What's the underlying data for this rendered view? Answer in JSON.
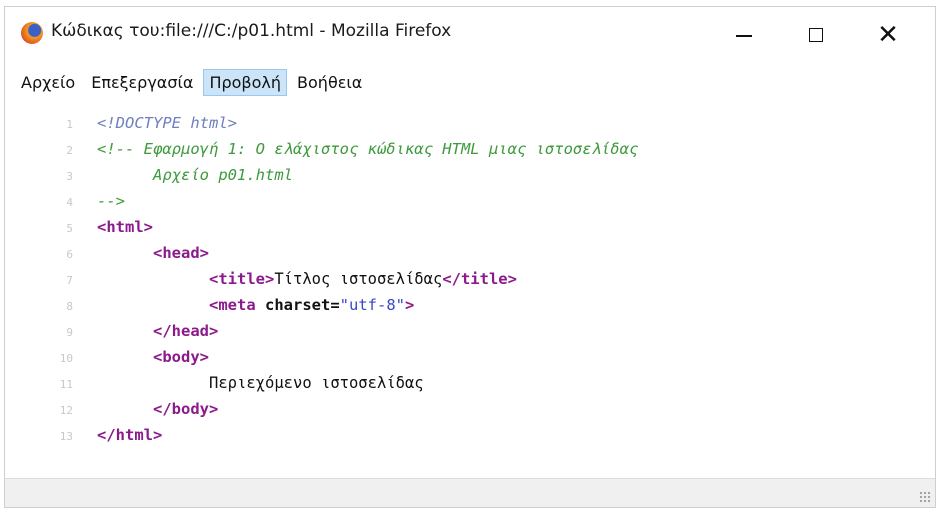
{
  "window": {
    "title": "Κώδικας του:file:///C:/p01.html - Mozilla Firefox"
  },
  "menu": {
    "items": [
      {
        "label": "Αρχείο"
      },
      {
        "label": "Επεξεργασία"
      },
      {
        "label": "Προβολή"
      },
      {
        "label": "Βοήθεια"
      }
    ]
  },
  "source": {
    "lines": [
      {
        "num": "1",
        "parts": [
          "<!DOCTYPE html>"
        ]
      },
      {
        "num": "2",
        "parts": [
          "<!-- Εφαρμογή 1: Ο ελάχιστος κώδικας HTML μιας ιστοσελίδας"
        ]
      },
      {
        "num": "3",
        "parts": [
          "Αρχείο p01.html"
        ]
      },
      {
        "num": "4",
        "parts": [
          "-->"
        ]
      },
      {
        "num": "5",
        "parts": [
          "<html>"
        ]
      },
      {
        "num": "6",
        "parts": [
          "<head>"
        ]
      },
      {
        "num": "7",
        "parts": [
          "<title>",
          "Τίτλος ιστοσελίδας",
          "</title>"
        ]
      },
      {
        "num": "8",
        "parts": [
          "<meta",
          "charset=",
          "\"utf-8\"",
          ">"
        ]
      },
      {
        "num": "9",
        "parts": [
          "</head>"
        ]
      },
      {
        "num": "10",
        "parts": [
          "<body>"
        ]
      },
      {
        "num": "11",
        "parts": [
          "Περιεχόμενο ιστοσελίδας"
        ]
      },
      {
        "num": "12",
        "parts": [
          "</body>"
        ]
      },
      {
        "num": "13",
        "parts": [
          "</html>"
        ]
      }
    ]
  },
  "colors": {
    "tag": "#8b1a8b",
    "comment": "#3d9a3d",
    "doctype": "#6f7fc1",
    "attr_value": "#3a48c9",
    "menu_highlight": "#cce4f7"
  }
}
